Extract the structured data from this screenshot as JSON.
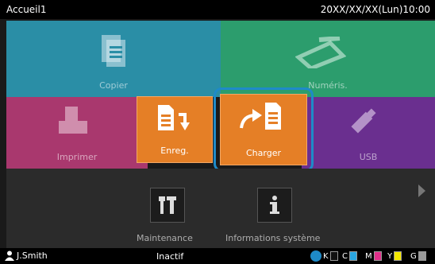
{
  "header": {
    "title": "Accueil1",
    "datetime": "20XX/XX/XX(Lun)10:00"
  },
  "tiles": {
    "copy": {
      "label": "Copier",
      "icon": "copy-icon"
    },
    "scan": {
      "label": "Numéris.",
      "icon": "scan-icon"
    },
    "print": {
      "label": "Imprimer",
      "icon": "print-icon"
    },
    "store": {
      "label": "Enreg.",
      "icon": "store-icon"
    },
    "load": {
      "label": "Charger",
      "icon": "load-icon"
    },
    "usb": {
      "label": "USB",
      "icon": "usb-icon"
    }
  },
  "functions": {
    "maintenance": {
      "label": "Maintenance",
      "icon": "tools-icon"
    },
    "info": {
      "label": "Informations système",
      "icon": "info-icon"
    }
  },
  "status": {
    "user": "J.Smith",
    "state": "Inactif",
    "inks": [
      {
        "key": "K",
        "color": "#000000",
        "level": 0.0
      },
      {
        "key": "C",
        "color": "#2aa6e0",
        "level": 1.0
      },
      {
        "key": "M",
        "color": "#e0308a",
        "level": 1.0
      },
      {
        "key": "Y",
        "color": "#f2e600",
        "level": 1.0
      },
      {
        "key": "G",
        "color": "#9a9a9a",
        "level": 1.0
      }
    ]
  },
  "colors": {
    "accent": "#1e8ac8",
    "active_tile": "#e57f26"
  }
}
